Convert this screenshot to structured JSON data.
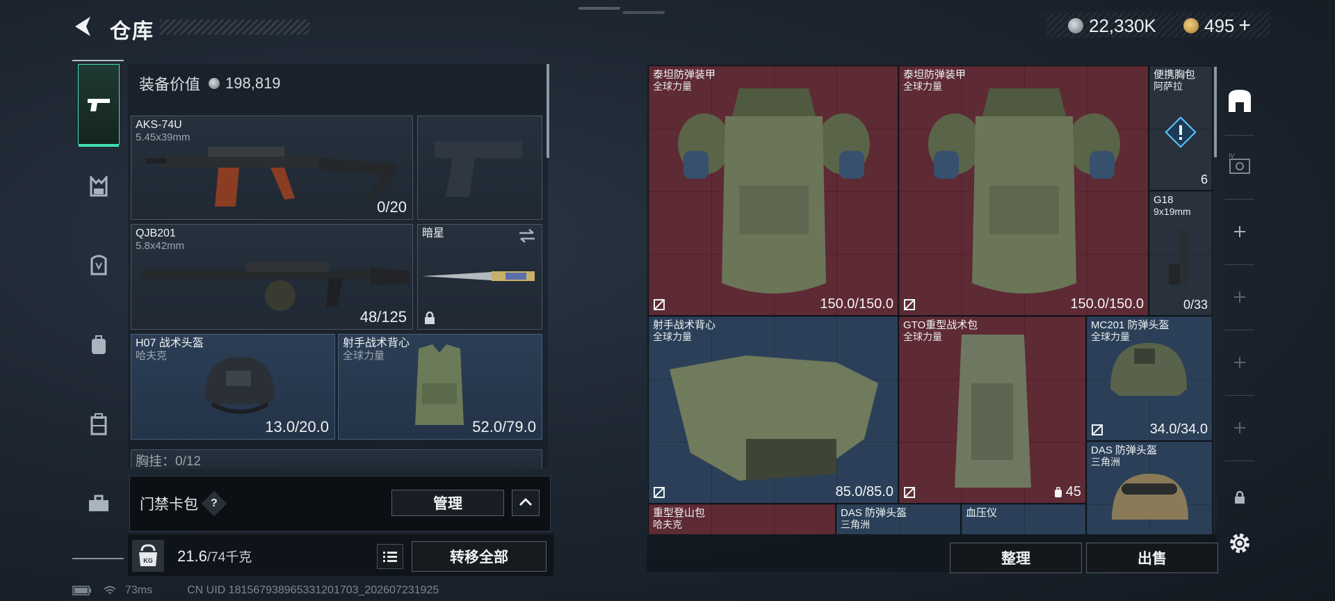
{
  "header": {
    "title": "仓库",
    "currency_1": "22,330K",
    "currency_2": "495",
    "currency_2_add": "+"
  },
  "equipment": {
    "value_label": "装备价值",
    "value": "198,819",
    "slots": [
      {
        "name": "AKS-74U",
        "sub": "5.45x39mm",
        "value": "0/20"
      },
      {
        "name": "QJB201",
        "sub": "5.8x42mm",
        "value": "48/125"
      },
      {
        "name": "暗星",
        "sub": "",
        "value": ""
      },
      {
        "name": "H07 战术头盔",
        "sub": "哈夫克",
        "value": "13.0/20.0"
      },
      {
        "name": "射手战术背心",
        "sub": "全球力量",
        "value": "52.0/79.0"
      }
    ],
    "chest_rig_label": "胸挂：0/12"
  },
  "card_pack": {
    "label": "门禁卡包",
    "help": "?",
    "manage_label": "管理"
  },
  "weight": {
    "current": "21.6",
    "max": "/74千克",
    "icon_text": "KG"
  },
  "transfer_all_label": "转移全部",
  "status": {
    "ping": "73ms",
    "uid": "CN UID 181567938965331201703_202607231925"
  },
  "grid_items": [
    {
      "name": "泰坦防弹装甲",
      "sub": "全球力量",
      "value": "150.0/150.0"
    },
    {
      "name": "泰坦防弹装甲",
      "sub": "全球力量",
      "value": "150.0/150.0"
    },
    {
      "name": "便携胸包",
      "sub": "阿萨拉",
      "value": "6"
    },
    {
      "name": "G18",
      "sub": "9x19mm",
      "value": "0/33"
    },
    {
      "name": "射手战术背心",
      "sub": "全球力量",
      "value": "85.0/85.0"
    },
    {
      "name": "GTO重型战术包",
      "sub": "全球力量",
      "value": "45"
    },
    {
      "name": "MC201 防弹头盔",
      "sub": "全球力量",
      "value": "34.0/34.0"
    },
    {
      "name": "DAS 防弹头盔",
      "sub": "三角洲",
      "value": ""
    },
    {
      "name": "重型登山包",
      "sub": "哈夫克",
      "value": ""
    },
    {
      "name": "DAS 防弹头盔",
      "sub": "三角洲",
      "value": ""
    },
    {
      "name": "血压仪",
      "sub": "",
      "value": ""
    }
  ],
  "actions": {
    "sort_label": "整理",
    "sell_label": "出售"
  },
  "colors": {
    "accent": "#3fe0b0",
    "rarity_red": "#5e2a34",
    "rarity_blue": "#2b4058"
  }
}
